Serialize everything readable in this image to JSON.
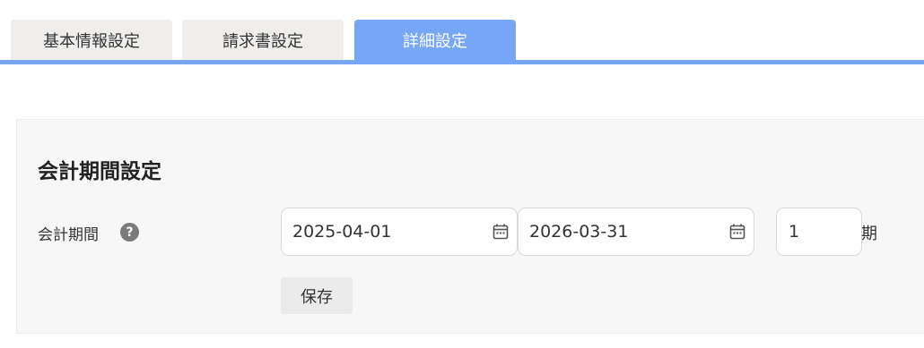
{
  "tabs": [
    {
      "label": "基本情報設定",
      "active": false
    },
    {
      "label": "請求書設定",
      "active": false
    },
    {
      "label": "詳細設定",
      "active": true
    }
  ],
  "section": {
    "title": "会計期間設定",
    "field_label": "会計期間",
    "help_icon": "?",
    "start_date": "2025-04-01",
    "end_date": "2026-03-31",
    "period_number": "1",
    "period_unit": "期",
    "save_label": "保存"
  },
  "colors": {
    "accent": "#78a6f7",
    "inactive_tab": "#efeeec",
    "card_bg": "#f7f7f7"
  }
}
